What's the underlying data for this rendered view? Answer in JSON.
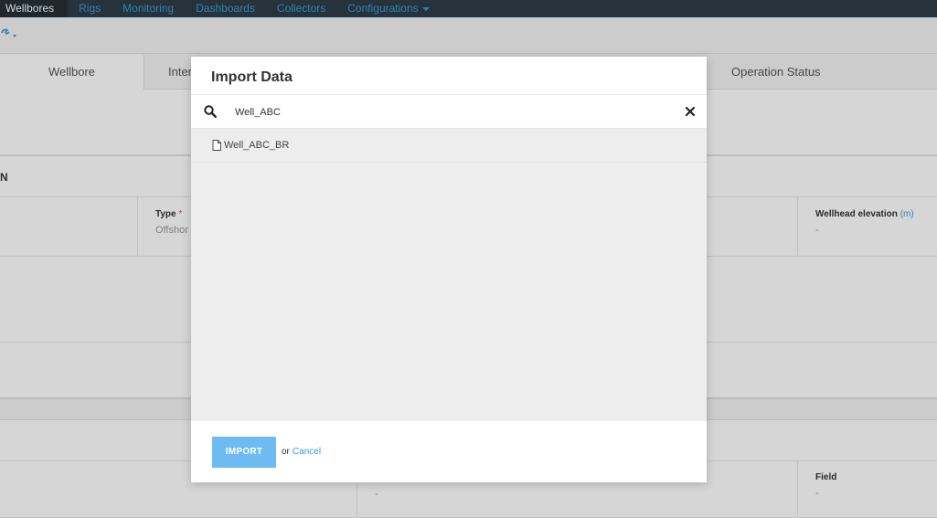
{
  "nav": {
    "items": [
      {
        "label": "Wellbores",
        "active": true
      },
      {
        "label": "Rigs"
      },
      {
        "label": "Monitoring"
      },
      {
        "label": "Dashboards"
      },
      {
        "label": "Collectors"
      },
      {
        "label": "Configurations"
      }
    ]
  },
  "tabs": {
    "wellbore_parameters": "Wellbore Parameters",
    "inter": "Inter",
    "operation_status": "Operation Status"
  },
  "section1": {
    "title": "N"
  },
  "fields": {
    "type_label": "Type",
    "type_required": "*",
    "type_value": "Offshor",
    "wellhead_label": "Wellhead elevation",
    "wellhead_unit": "(m)",
    "wellhead_value": "-",
    "field_label": "Field",
    "field_value": "-",
    "mid_value": "-"
  },
  "modal": {
    "title": "Import Data",
    "search_value": "Well_ABC",
    "results": [
      "Well_ABC_BR"
    ],
    "import_label": "IMPORT",
    "or_text": "or",
    "cancel_label": "Cancel"
  },
  "colors": {
    "nav_bg": "#2f3d47",
    "link": "#3a9ad9",
    "import_button": "#6ebbf1"
  }
}
